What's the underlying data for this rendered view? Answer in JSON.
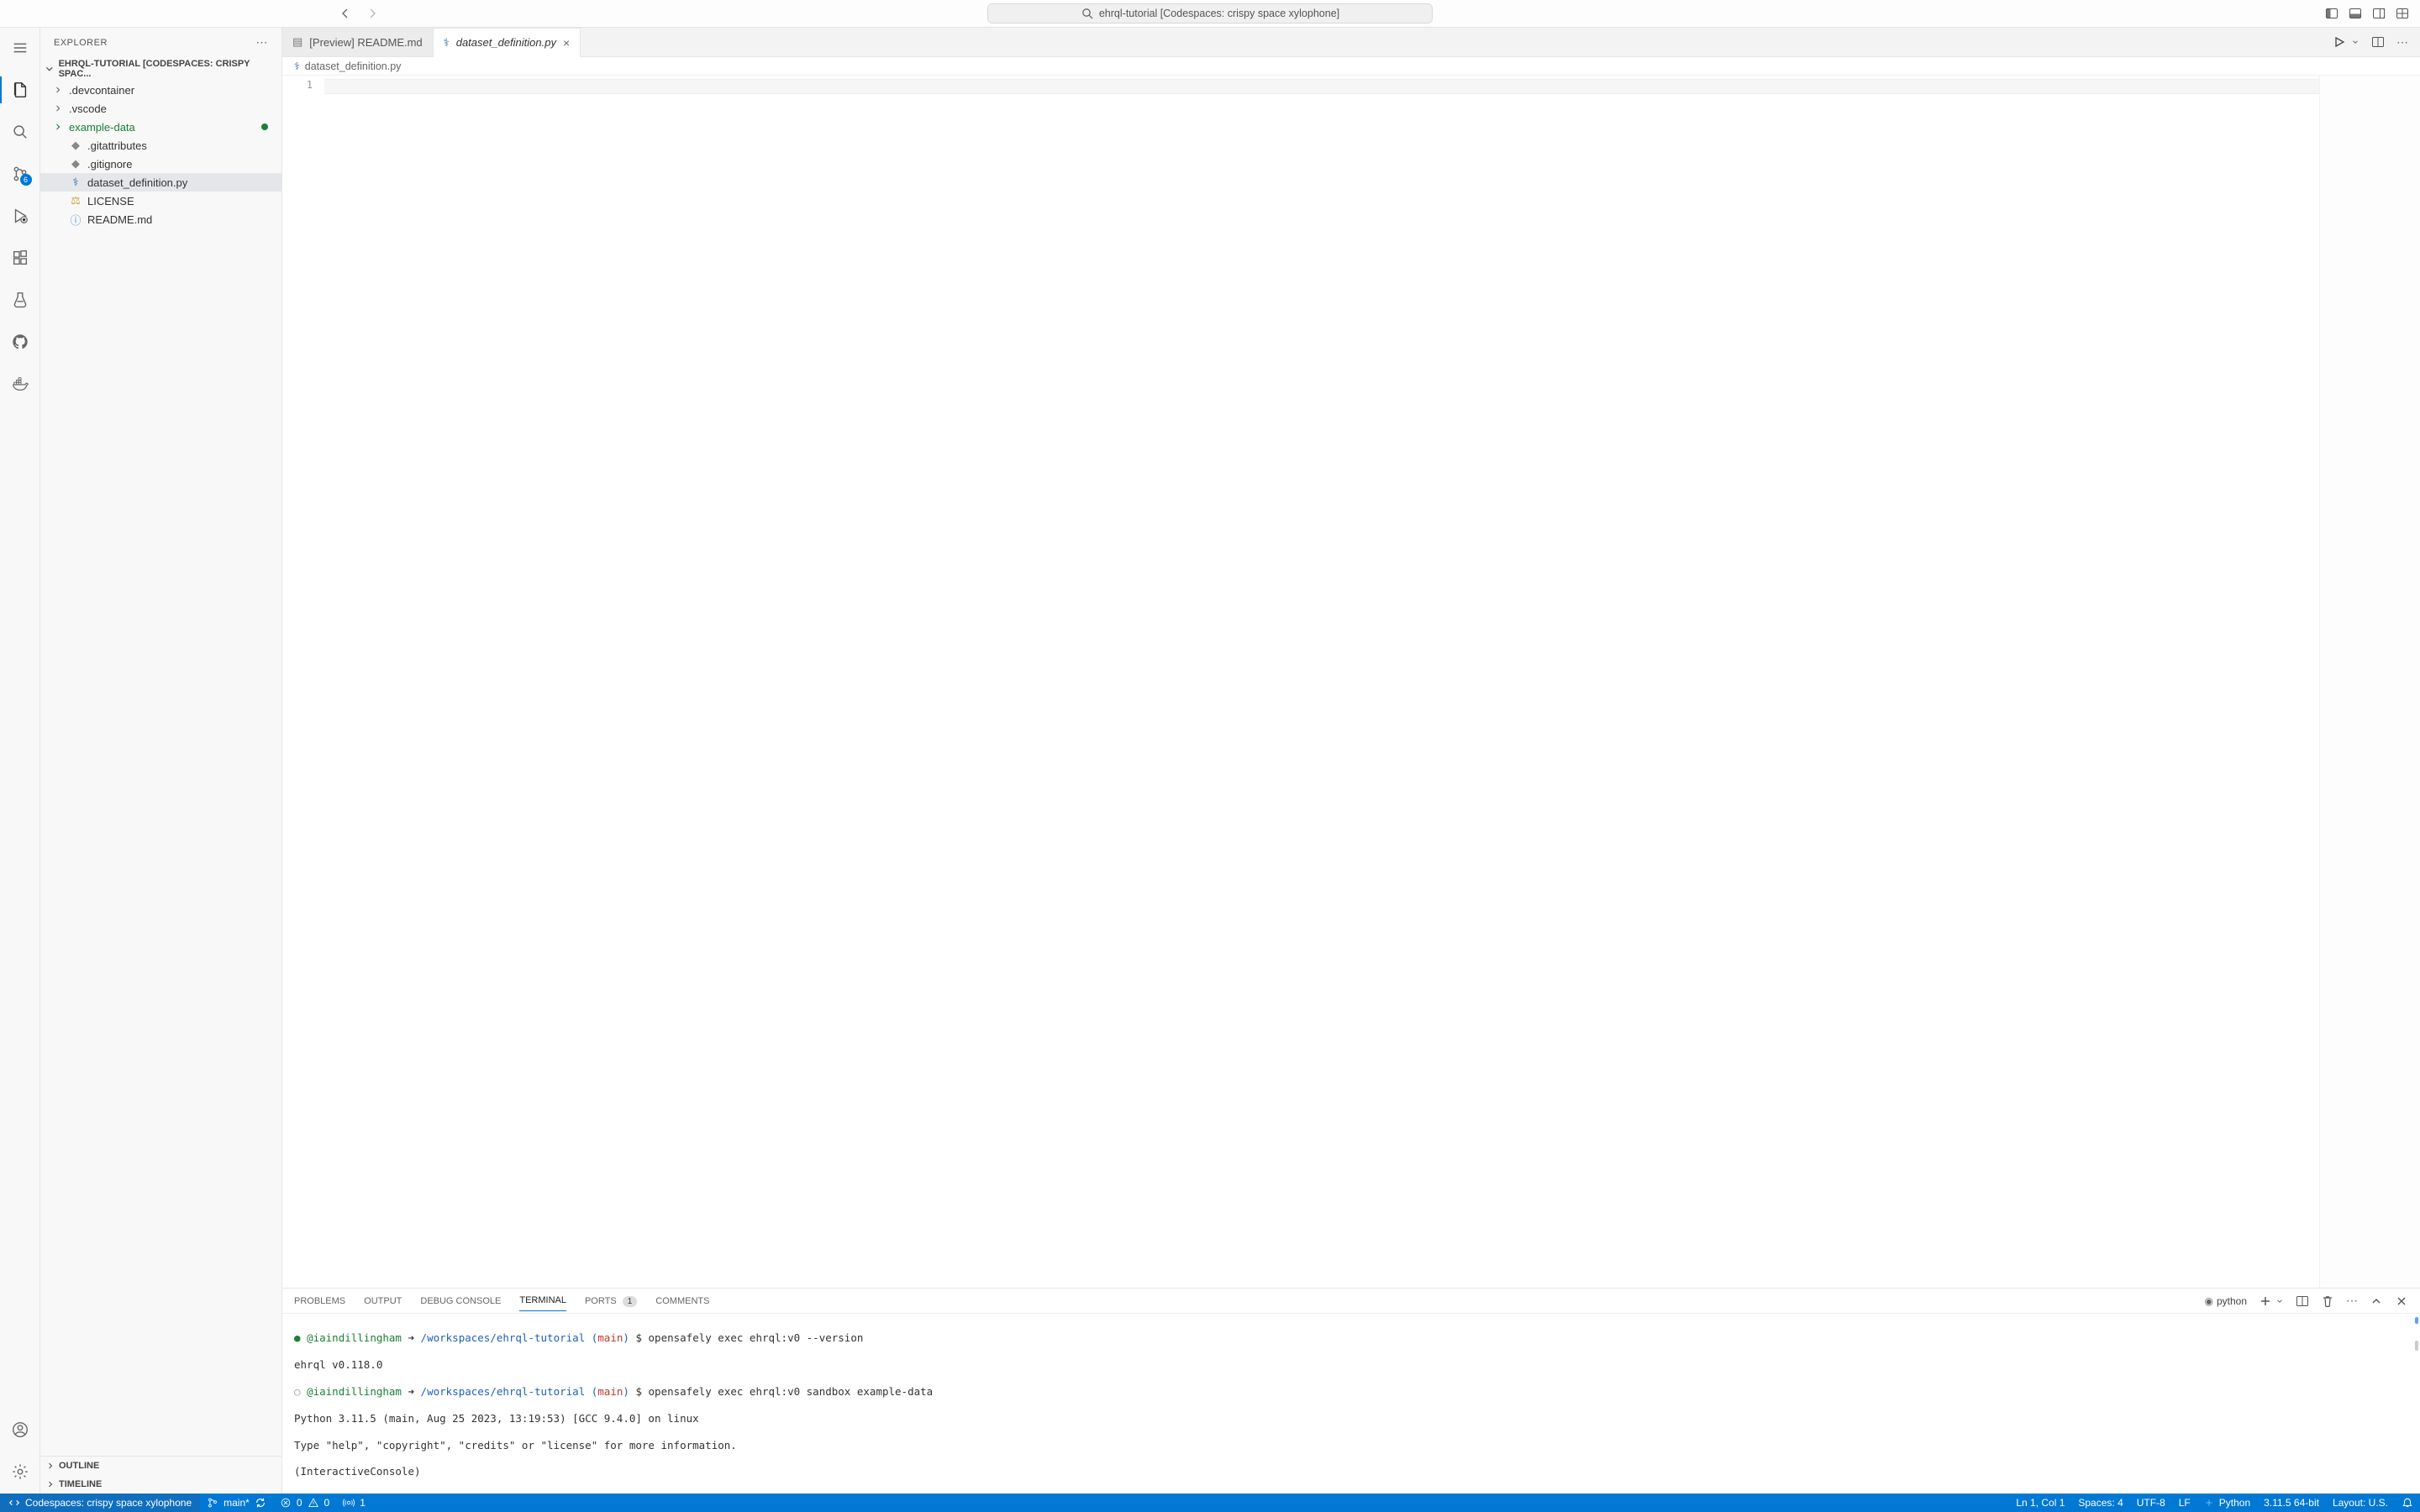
{
  "titlebar": {
    "search_text": "ehrql-tutorial [Codespaces: crispy space xylophone]"
  },
  "activity_bar": {
    "scm_badge": "6"
  },
  "sidebar": {
    "title": "EXPLORER",
    "root_label": "EHRQL-TUTORIAL [CODESPACES: CRISPY SPAC...",
    "items": [
      {
        "name": ".devcontainer",
        "kind": "folder"
      },
      {
        "name": ".vscode",
        "kind": "folder"
      },
      {
        "name": "example-data",
        "kind": "folder",
        "modified": true
      },
      {
        "name": ".gitattributes",
        "kind": "file"
      },
      {
        "name": ".gitignore",
        "kind": "file"
      },
      {
        "name": "dataset_definition.py",
        "kind": "file",
        "selected": true
      },
      {
        "name": "LICENSE",
        "kind": "file"
      },
      {
        "name": "README.md",
        "kind": "file"
      }
    ],
    "outline_label": "OUTLINE",
    "timeline_label": "TIMELINE"
  },
  "tabs": [
    {
      "label": "[Preview] README.md",
      "active": false,
      "icon": "preview"
    },
    {
      "label": "dataset_definition.py",
      "active": true,
      "icon": "python"
    }
  ],
  "breadcrumb": {
    "file": "dataset_definition.py"
  },
  "editor": {
    "line_number": "1"
  },
  "panel": {
    "tabs": {
      "problems": "PROBLEMS",
      "output": "OUTPUT",
      "debug": "DEBUG CONSOLE",
      "terminal": "TERMINAL",
      "ports": "PORTS",
      "ports_badge": "1",
      "comments": "COMMENTS"
    },
    "terminal_kind": "python",
    "terminal_lines": {
      "l1_user": "@iaindillingham",
      "l1_arrow": "➜",
      "l1_path": "/workspaces/ehrql-tutorial",
      "l1_branch_open": "(",
      "l1_branch": "main",
      "l1_branch_close": ")",
      "l1_prompt": "$",
      "l1_cmd": "opensafely exec ehrql:v0 --version",
      "l2": "ehrql v0.118.0",
      "l3_cmd": "opensafely exec ehrql:v0 sandbox example-data",
      "l4": "Python 3.11.5 (main, Aug 25 2023, 13:19:53) [GCC 9.4.0] on linux",
      "l5": "Type \"help\", \"copyright\", \"credits\" or \"license\" for more information.",
      "l6": "(InteractiveConsole)",
      "l7": ">>> "
    }
  },
  "statusbar": {
    "remote": "Codespaces: crispy space xylophone",
    "branch": "main*",
    "errors": "0",
    "warnings": "0",
    "ports": "1",
    "cursor": "Ln 1, Col 1",
    "spaces": "Spaces: 4",
    "encoding": "UTF-8",
    "eol": "LF",
    "lang": "Python",
    "interpreter": "3.11.5 64-bit",
    "layout": "Layout: U.S."
  }
}
